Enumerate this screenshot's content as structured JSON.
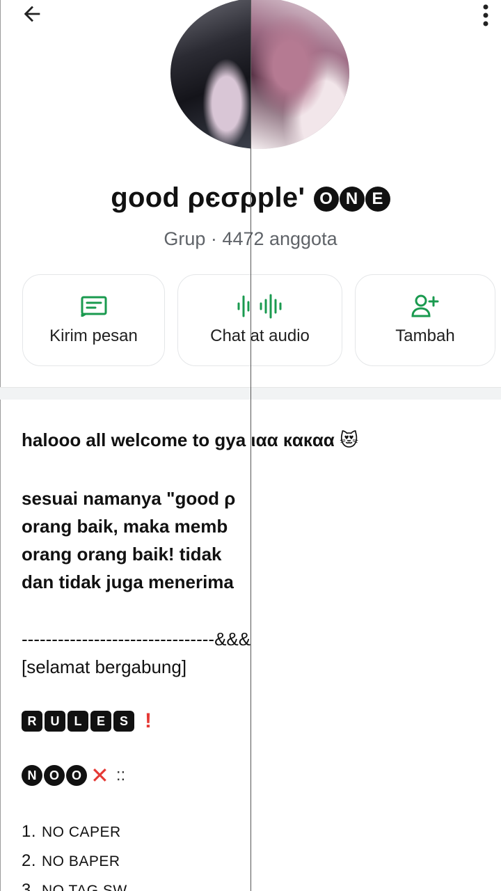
{
  "header": {
    "back_icon": "arrow-left-icon",
    "more_icon": "more-vert-icon"
  },
  "group": {
    "name": "good ρєσρple'",
    "name_badges": [
      "O",
      "N",
      "E"
    ],
    "subtitle": "Grup · 4472 anggota"
  },
  "actions": [
    {
      "label": "Kirim pesan",
      "icon": "message-icon"
    },
    {
      "label": "Chat at audio",
      "icon": "audio-wave-icon"
    },
    {
      "label": "Tambah",
      "icon": "add-person-icon"
    }
  ],
  "colors": {
    "accent": "#1a9a4f",
    "danger": "#e53935"
  },
  "description": {
    "welcome": "halooo all welcome to gya ιαα кαкαα 😻",
    "about_lines": [
      "sesuai namanya \"good ρ",
      "orang baik, maka memb",
      "orang orang baik! tidak",
      "dan tidak juga menerima"
    ],
    "separator": "--------------------------------&&&&",
    "joined": "[selamat bergabung]",
    "rules_letters": [
      "R",
      "U",
      "L",
      "E",
      "S"
    ],
    "rules_mark": "!",
    "noo_letters": [
      "N",
      "O",
      "O"
    ],
    "noo_x": "✕",
    "noo_suffix": "::",
    "rules": [
      {
        "num": "1.",
        "text": "NO CAPER"
      },
      {
        "num": "2.",
        "text": "NO BAPER"
      },
      {
        "num": "3.",
        "text": "NO TAG SW"
      }
    ]
  }
}
